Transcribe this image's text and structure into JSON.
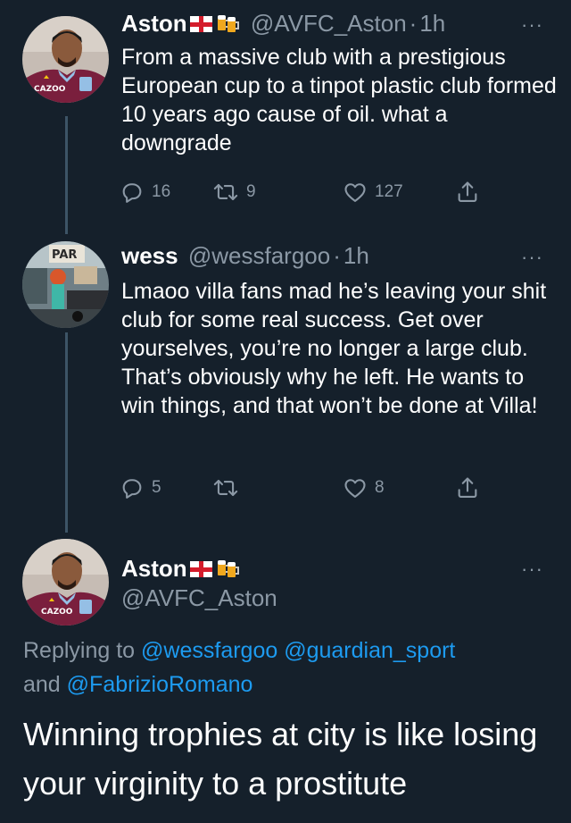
{
  "tweets": [
    {
      "name": "Aston",
      "handle": "@AVFC_Aston",
      "dot": "·",
      "time": "1h",
      "more": "···",
      "text": "From a massive club with a prestigious European cup to a tinpot plastic club formed 10 years ago cause of oil. what a downgrade",
      "avatar_text": "CAZOO",
      "replies": "16",
      "retweets": "9",
      "likes": "127"
    },
    {
      "name": "wess",
      "handle": "@wessfargoo",
      "dot": "·",
      "time": "1h",
      "more": "···",
      "text": "Lmaoo villa fans mad he’s leaving your shit club for some real success. Get over yourselves, you’re no longer a large club. That’s obviously why he left. He wants to win things, and that won’t be done at Villa!",
      "avatar_sign": "PAR",
      "replies": "5",
      "retweets": "",
      "likes": "8"
    }
  ],
  "main_tweet": {
    "name": "Aston",
    "handle": "@AVFC_Aston",
    "more": "···",
    "avatar_text": "CAZOO",
    "replying_prefix": "Replying to",
    "mention_1": "@wessfargoo",
    "mention_2": "@guardian_sport",
    "and_word": "and",
    "mention_3": "@FabrizioRomano",
    "text": "Winning trophies at city is like losing your virginity to a prostitute"
  },
  "icons": {
    "reply": "reply-icon",
    "retweet": "retweet-icon",
    "like": "heart-icon",
    "share": "share-icon",
    "flag": "england-flag-icon",
    "beer": "beer-mugs-icon"
  },
  "colors": {
    "background": "#15202b",
    "text": "#ffffff",
    "muted": "#8b98a5",
    "link": "#1d9bf0",
    "thread_line": "#3d5466"
  }
}
